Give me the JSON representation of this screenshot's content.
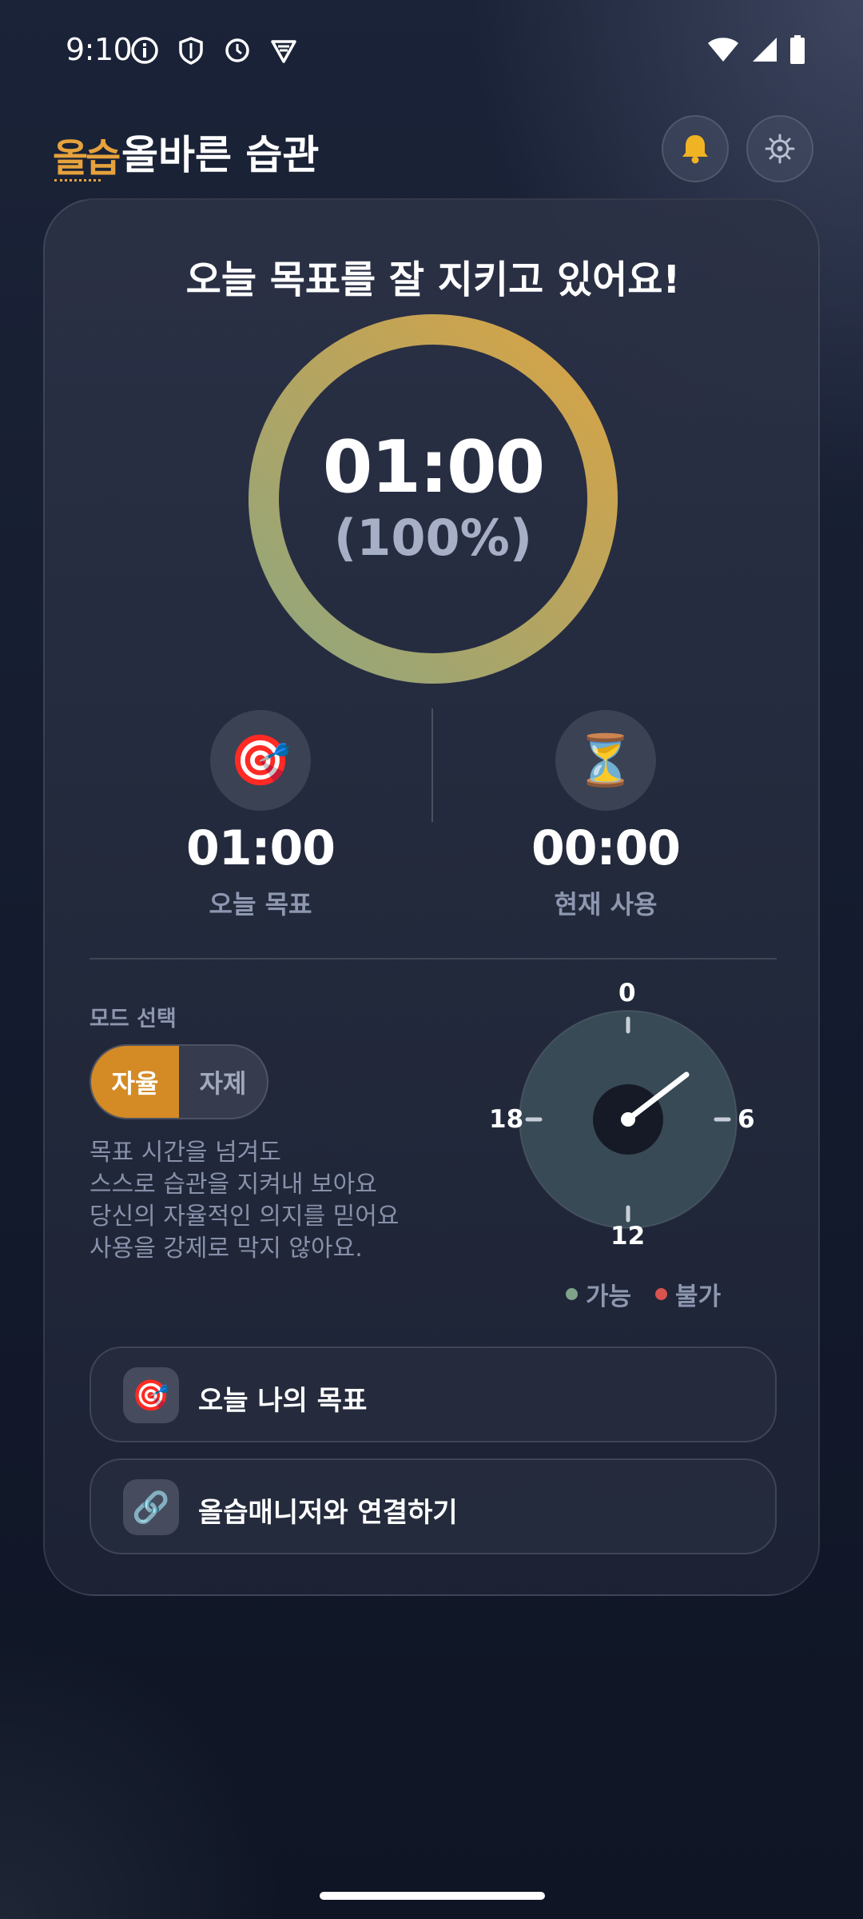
{
  "status_bar": {
    "time": "9:10",
    "icons": [
      "info-icon",
      "shield-icon",
      "clock-icon",
      "vpn-icon",
      "wifi-icon",
      "signal-icon",
      "battery-icon"
    ]
  },
  "header": {
    "logo": "올습",
    "title": "올바른 습관",
    "notification_icon": "bell-icon",
    "settings_icon": "gear-icon"
  },
  "summary": {
    "title": "오늘 목표를 잘 지키고 있어요!",
    "time": "01:00",
    "percent_text": "(100%)",
    "progress": 1.0,
    "ring_colors": [
      "#8fa67e",
      "#d9a344"
    ]
  },
  "stats": {
    "goal": {
      "icon": "target-icon",
      "value": "01:00",
      "label": "오늘 목표"
    },
    "usage": {
      "icon": "hourglass-icon",
      "value": "00:00",
      "label": "현재 사용"
    }
  },
  "mode": {
    "label": "모드 선택",
    "options": [
      "자율",
      "자제"
    ],
    "selected": "자율",
    "accent_color": "#d48b26",
    "description": [
      "목표 시간을 넘겨도",
      "스스로 습관을 지켜내 보아요",
      "당신의 자율적인 의지를 믿어요",
      "사용을 강제로 막지 않아요."
    ]
  },
  "dial": {
    "labels": {
      "top": "0",
      "right": "6",
      "bottom": "12",
      "left": "18"
    },
    "hand_hour": 3.5,
    "legend": [
      {
        "label": "가능",
        "color": "#7fa388"
      },
      {
        "label": "불가",
        "color": "#d9534f"
      }
    ]
  },
  "actions": [
    {
      "icon": "target-icon",
      "label": "오늘 나의 목표"
    },
    {
      "icon": "link-icon",
      "label": "올습매니저와 연결하기"
    }
  ]
}
